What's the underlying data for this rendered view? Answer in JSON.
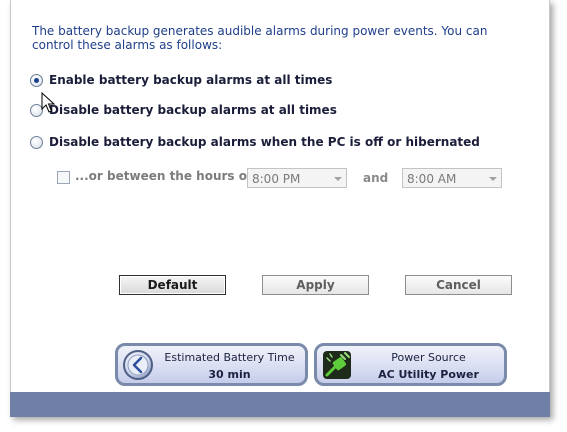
{
  "intro_text": "The battery backup generates audible alarms during power events. You can control these alarms as follows:",
  "options": [
    {
      "label": "Enable battery backup alarms at all times",
      "checked": true
    },
    {
      "label": "Disable battery backup alarms at all times",
      "checked": false
    },
    {
      "label": "Disable battery backup alarms when the PC is off or hibernated",
      "checked": false
    }
  ],
  "hours": {
    "label": "...or between the hours of",
    "checked": false,
    "start": "8:00 PM",
    "and_label": "and",
    "end": "8:00 AM"
  },
  "buttons": {
    "default": "Default",
    "apply": "Apply",
    "cancel": "Cancel"
  },
  "status": {
    "battery_title": "Estimated Battery Time",
    "battery_value": "30 min",
    "power_title": "Power Source",
    "power_value": "AC Utility Power"
  },
  "colors": {
    "panel_border": "#7a8aaa",
    "bottom_bar": "#6f7fa6",
    "intro_text": "#1f3f8a"
  },
  "icons": {
    "battery": "clock-icon",
    "power": "power-plug-icon"
  }
}
